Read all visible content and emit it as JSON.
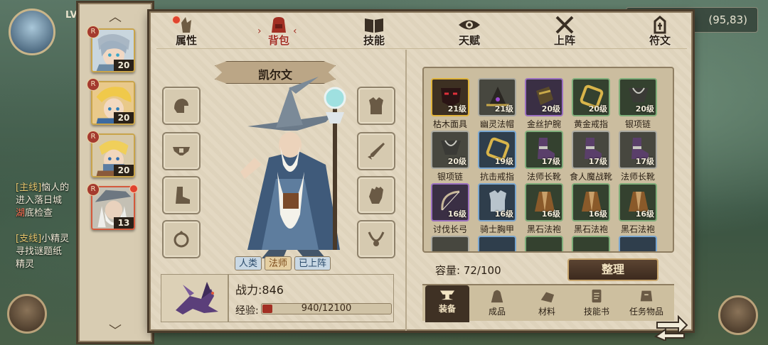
{
  "hud": {
    "level_prefix": "LV",
    "coords": "(95,83)",
    "quest_main_tag": "[主线]",
    "quest_main_title": "恼人的",
    "quest_main_desc1": "进入落日城",
    "quest_main_desc2_red": "湖",
    "quest_main_desc2": "底检查",
    "quest_side_tag": "[支线]",
    "quest_side_title": "小精灵",
    "quest_side_desc1": "寻找谜题纸",
    "quest_side_desc2": "精灵"
  },
  "heroes": [
    {
      "level": "20",
      "badge": "R"
    },
    {
      "level": "20",
      "badge": "R"
    },
    {
      "level": "20",
      "badge": "R"
    },
    {
      "level": "13",
      "badge": "R",
      "selected": true
    }
  ],
  "tabs": [
    {
      "label": "属性",
      "icon": "attributes-icon"
    },
    {
      "label": "背包",
      "icon": "backpack-icon",
      "active": true
    },
    {
      "label": "技能",
      "icon": "skill-book-icon"
    },
    {
      "label": "天赋",
      "icon": "talent-eye-icon"
    },
    {
      "label": "上阵",
      "icon": "crossed-swords-icon"
    },
    {
      "label": "符文",
      "icon": "rune-icon"
    }
  ],
  "character": {
    "name": "凯尔文",
    "tags": [
      "人类",
      "法师",
      "已上阵"
    ],
    "power_label": "战力:",
    "power_value": "846",
    "exp_label": "经验:",
    "exp_text": "940/12100",
    "exp_fraction": 0.0777
  },
  "equipment_slots": [
    "helmet-slot-icon",
    "belt-slot-icon",
    "boots-slot-icon",
    "ring-slot-icon",
    "armor-slot-icon",
    "weapon-slot-icon",
    "gloves-slot-icon",
    "necklace-slot-icon"
  ],
  "inventory": {
    "items": [
      {
        "name": "枯木面具",
        "level": "21级",
        "rarity": "gold",
        "icon": "mask-icon"
      },
      {
        "name": "幽灵法帽",
        "level": "21级",
        "rarity": "gray",
        "icon": "hat-icon"
      },
      {
        "name": "金丝护腕",
        "level": "20级",
        "rarity": "purple",
        "icon": "bracer-icon"
      },
      {
        "name": "黄金戒指",
        "level": "20级",
        "rarity": "green",
        "icon": "ring-icon"
      },
      {
        "name": "银项链",
        "level": "20级",
        "rarity": "green",
        "icon": "necklace-icon"
      },
      {
        "name": "银项链",
        "level": "20级",
        "rarity": "gray",
        "icon": "necklace-icon"
      },
      {
        "name": "抗击戒指",
        "level": "19级",
        "rarity": "blue",
        "icon": "ring-icon"
      },
      {
        "name": "法师长靴",
        "level": "17级",
        "rarity": "green",
        "icon": "boots-icon"
      },
      {
        "name": "食人魔战靴",
        "level": "17级",
        "rarity": "gray",
        "icon": "boots-icon"
      },
      {
        "name": "法师长靴",
        "level": "17级",
        "rarity": "gray",
        "icon": "boots-icon"
      },
      {
        "name": "讨伐长弓",
        "level": "16级",
        "rarity": "purple",
        "icon": "bow-icon"
      },
      {
        "name": "骑士胸甲",
        "level": "16级",
        "rarity": "blue",
        "icon": "chestplate-icon"
      },
      {
        "name": "黑石法袍",
        "level": "16级",
        "rarity": "green",
        "icon": "robe-icon"
      },
      {
        "name": "黑石法袍",
        "level": "16级",
        "rarity": "green",
        "icon": "robe-icon"
      },
      {
        "name": "黑石法袍",
        "level": "16级",
        "rarity": "green",
        "icon": "robe-icon"
      }
    ],
    "capacity_label": "容量:",
    "capacity_value": "72/100",
    "sort_label": "整理"
  },
  "categories": [
    {
      "label": "装备",
      "icon": "anvil-icon",
      "active": true
    },
    {
      "label": "成品",
      "icon": "bag-icon"
    },
    {
      "label": "材料",
      "icon": "material-icon"
    },
    {
      "label": "技能书",
      "icon": "scroll-icon"
    },
    {
      "label": "任务物品",
      "icon": "quest-item-icon"
    }
  ]
}
